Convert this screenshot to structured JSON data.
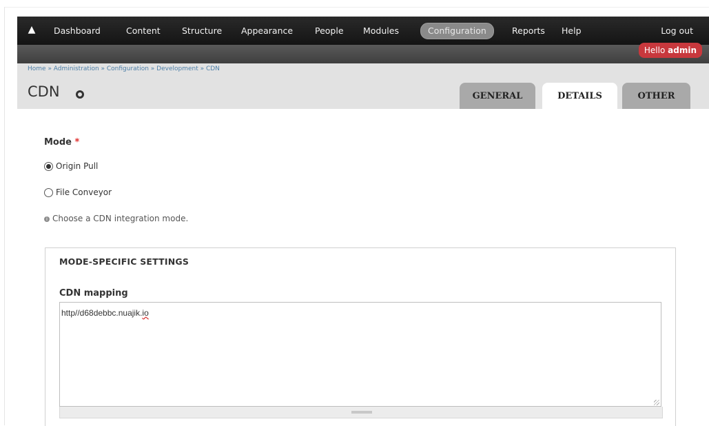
{
  "toolbar": {
    "home_icon": "home-icon",
    "items": [
      "Dashboard",
      "Content",
      "Structure",
      "Appearance",
      "People",
      "Modules",
      "Configuration",
      "Reports",
      "Help"
    ],
    "active_item": "Configuration",
    "logout": "Log out"
  },
  "user_badge": {
    "greeting": "Hello",
    "username": "admin",
    "color": "#c8383d"
  },
  "breadcrumb": "Home » Administration » Configuration » Development » CDN",
  "page": {
    "title": "CDN",
    "title_icon": "gear-icon"
  },
  "tabs": [
    {
      "label": "GENERAL",
      "active": false
    },
    {
      "label": "DETAILS",
      "active": true
    },
    {
      "label": "OTHER",
      "active": false
    }
  ],
  "form": {
    "mode": {
      "label": "Mode",
      "required_marker": "*",
      "options": [
        {
          "label": "Origin Pull",
          "checked": true
        },
        {
          "label": "File Conveyor",
          "checked": false
        }
      ],
      "help_icon": "info-icon",
      "help": "Choose a CDN integration mode."
    },
    "mode_specific": {
      "legend": "MODE-SPECIFIC SETTINGS",
      "cdn_mapping": {
        "label": "CDN mapping",
        "value_prefix": "http//d68debbc.nuajik.",
        "value_misspelled": "io"
      }
    }
  }
}
